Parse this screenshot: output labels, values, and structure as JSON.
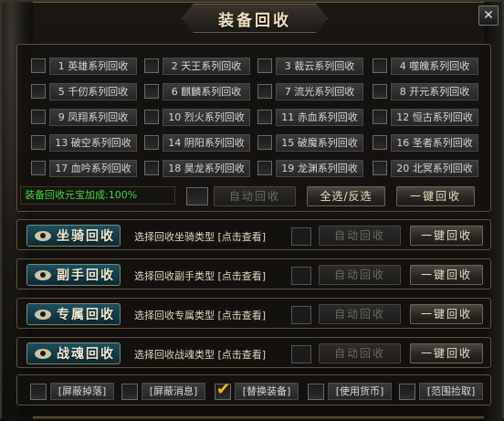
{
  "window": {
    "title": "装备回收",
    "close_glyph": "✕"
  },
  "series": [
    {
      "label": "1 英雄系列回收",
      "checked": false
    },
    {
      "label": "2 天王系列回收",
      "checked": false
    },
    {
      "label": "3 裁云系列回收",
      "checked": false
    },
    {
      "label": "4 噬魄系列回收",
      "checked": false
    },
    {
      "label": "5 千仞系列回收",
      "checked": false
    },
    {
      "label": "6 麒麟系列回收",
      "checked": false
    },
    {
      "label": "7 流光系列回收",
      "checked": false
    },
    {
      "label": "8 开元系列回收",
      "checked": false
    },
    {
      "label": "9 凤翔系列回收",
      "checked": false
    },
    {
      "label": "10 烈火系列回收",
      "checked": false
    },
    {
      "label": "11 赤血系列回收",
      "checked": false
    },
    {
      "label": "12 恒古系列回收",
      "checked": false
    },
    {
      "label": "13 破空系列回收",
      "checked": false
    },
    {
      "label": "14 阴阳系列回收",
      "checked": false
    },
    {
      "label": "15 破魔系列回收",
      "checked": false
    },
    {
      "label": "16 圣者系列回收",
      "checked": false
    },
    {
      "label": "17 血吟系列回收",
      "checked": false
    },
    {
      "label": "18 昊龙系列回收",
      "checked": false
    },
    {
      "label": "19 龙渊系列回收",
      "checked": false
    },
    {
      "label": "20 北冥系列回收",
      "checked": false
    }
  ],
  "main": {
    "bonus_text": "装备回收元宝加成:100%",
    "auto_recycle": "自动回收",
    "select_all": "全选/反选",
    "one_key": "一键回收"
  },
  "categories": [
    {
      "badge": "坐骑回收",
      "desc": "选择回收坐骑类型 [点击查看]",
      "auto": "自动回收",
      "one_key": "一键回收"
    },
    {
      "badge": "副手回收",
      "desc": "选择回收副手类型 [点击查看]",
      "auto": "自动回收",
      "one_key": "一键回收"
    },
    {
      "badge": "专属回收",
      "desc": "选择回收专属类型 [点击查看]",
      "auto": "自动回收",
      "one_key": "一键回收"
    },
    {
      "badge": "战魂回收",
      "desc": "选择回收战魂类型 [点击查看]",
      "auto": "自动回收",
      "one_key": "一键回收"
    }
  ],
  "options": [
    {
      "label": "[屏蔽掉落]",
      "checked": false
    },
    {
      "label": "[屏蔽消息]",
      "checked": false
    },
    {
      "label": "[替换装备]",
      "checked": true
    },
    {
      "label": "[使用货币]",
      "checked": false
    },
    {
      "label": "[范围捡取]",
      "checked": false
    }
  ],
  "colors": {
    "bonus_green": "#48d845",
    "check_yellow": "#f2c500",
    "badge_teal": "#1d4e5e"
  }
}
